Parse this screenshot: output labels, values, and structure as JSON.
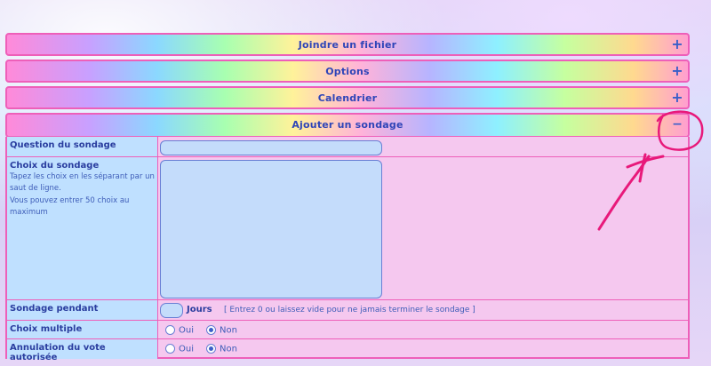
{
  "sections": {
    "attach_title": "Joindre un fichier",
    "options_title": "Options",
    "calendar_title": "Calendrier",
    "poll_title": "Ajouter un sondage",
    "expand_icon": "+",
    "collapse_icon": "−"
  },
  "poll_form": {
    "question_label": "Question du sondage",
    "question_value": "",
    "choices_label": "Choix du sondage",
    "choices_hint_1": "Tapez les choix en les séparant par un saut de ligne.",
    "choices_hint_2": "Vous pouvez entrer 50 choix au maximum",
    "choices_value": "",
    "duration_label": "Sondage pendant",
    "duration_unit": "Jours",
    "duration_hint": "[ Entrez 0 ou laissez vide pour ne jamais terminer le sondage ]",
    "multiple_label": "Choix multiple",
    "cancel_label": "Annulation du vote autorisée",
    "yes": "Oui",
    "no": "Non",
    "multiple_selected": "Non",
    "cancel_selected": "Non"
  },
  "colors": {
    "border_pink": "#ee5fb9",
    "label_blue": "#bfe0ff",
    "form_pink": "#f5c8ef",
    "annotation": "#e8197a"
  }
}
